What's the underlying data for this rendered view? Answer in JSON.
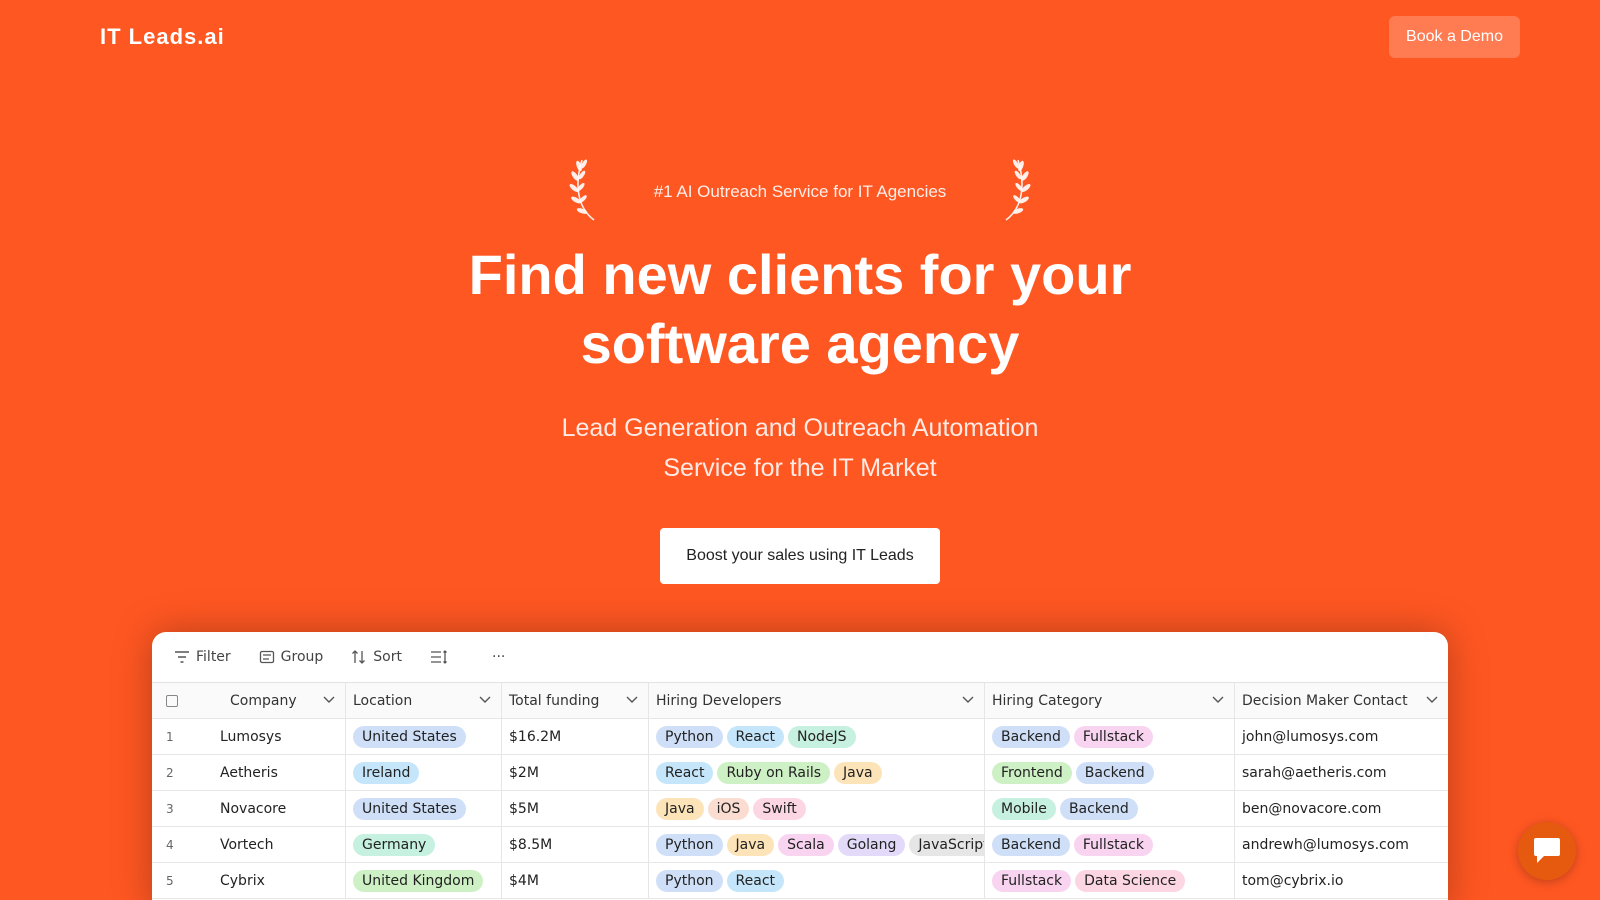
{
  "nav": {
    "logo": "IT Leads.ai",
    "demo_label": "Book a Demo"
  },
  "hero": {
    "badge": "#1 AI Outreach Service for IT Agencies",
    "headline_line1": "Find new clients for your",
    "headline_line2": "software agency",
    "subhead_line1": "Lead Generation and Outreach Automation",
    "subhead_line2": "Service for the IT Market",
    "cta_label": "Boost your sales using IT Leads"
  },
  "toolbar": {
    "filter": "Filter",
    "group": "Group",
    "sort": "Sort",
    "more": "···"
  },
  "table": {
    "columns": [
      "Company",
      "Location",
      "Total funding",
      "Hiring Developers",
      "Hiring Category",
      "Decision Maker Contact"
    ],
    "rows": [
      {
        "num": "1",
        "company": "Lumosys",
        "location": "United States",
        "funding": "$16.2M",
        "devs": [
          "Python",
          "React",
          "NodeJS"
        ],
        "cats": [
          "Backend",
          "Fullstack"
        ],
        "contact": "john@lumosys.com"
      },
      {
        "num": "2",
        "company": "Aetheris",
        "location": "Ireland",
        "funding": "$2M",
        "devs": [
          "React",
          "Ruby on Rails",
          "Java"
        ],
        "cats": [
          "Frontend",
          "Backend"
        ],
        "contact": "sarah@aetheris.com"
      },
      {
        "num": "3",
        "company": "Novacore",
        "location": "United States",
        "funding": "$5M",
        "devs": [
          "Java",
          "iOS",
          "Swift"
        ],
        "cats": [
          "Mobile",
          "Backend"
        ],
        "contact": "ben@novacore.com"
      },
      {
        "num": "4",
        "company": "Vortech",
        "location": "Germany",
        "funding": "$8.5M",
        "devs": [
          "Python",
          "Java",
          "Scala",
          "Golang",
          "JavaScript"
        ],
        "cats": [
          "Backend",
          "Fullstack"
        ],
        "contact": "andrewh@lumosys.com"
      },
      {
        "num": "5",
        "company": "Cybrix",
        "location": "United Kingdom",
        "funding": "$4M",
        "devs": [
          "Python",
          "React"
        ],
        "cats": [
          "Fullstack",
          "Data Science"
        ],
        "contact": "tom@cybrix.io"
      }
    ]
  },
  "colors": {
    "brand_orange": "#FF5722",
    "tag_colors": {
      "United States": "#cfdff8",
      "Ireland": "#c5e6fa",
      "Germany": "#c6f0df",
      "United Kingdom": "#cdf1c4",
      "Python": "#cfdff8",
      "React": "#c5e6fa",
      "NodeJS": "#c6f0df",
      "Ruby on Rails": "#cdf1c4",
      "Java": "#fde3b8",
      "iOS": "#fbdcd0",
      "Swift": "#fcd6e3",
      "Scala": "#f9d4f1",
      "Golang": "#e2daf8",
      "JavaScript": "#e6e6e6",
      "Backend": "#cfdff8",
      "Fullstack": "#f9d4f1",
      "Frontend": "#cdf1c4",
      "Mobile": "#c6f0df",
      "Data Science": "#fcd6e3"
    }
  }
}
